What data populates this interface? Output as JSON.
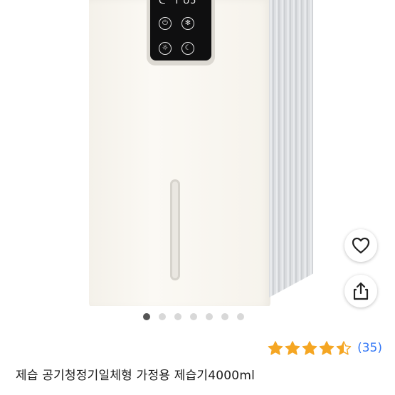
{
  "display": {
    "left_readout": "ᑕ ᒣ",
    "right_readout": "ᑌ5"
  },
  "carousel": {
    "total": 7,
    "active_index": 0
  },
  "rating": {
    "stars": 4.5,
    "max": 5,
    "count_label": "(35)",
    "star_color": "#f5a623"
  },
  "product": {
    "title": "제습 공기청정기일체형 가정용 제습기4000ml"
  },
  "colors": {
    "link": "#3478f6",
    "dot_active": "#555555",
    "dot_inactive": "#d8d8d8"
  },
  "icons": [
    "power-icon",
    "gear-icon",
    "light-icon",
    "moon-icon",
    "heart-icon",
    "share-icon"
  ]
}
